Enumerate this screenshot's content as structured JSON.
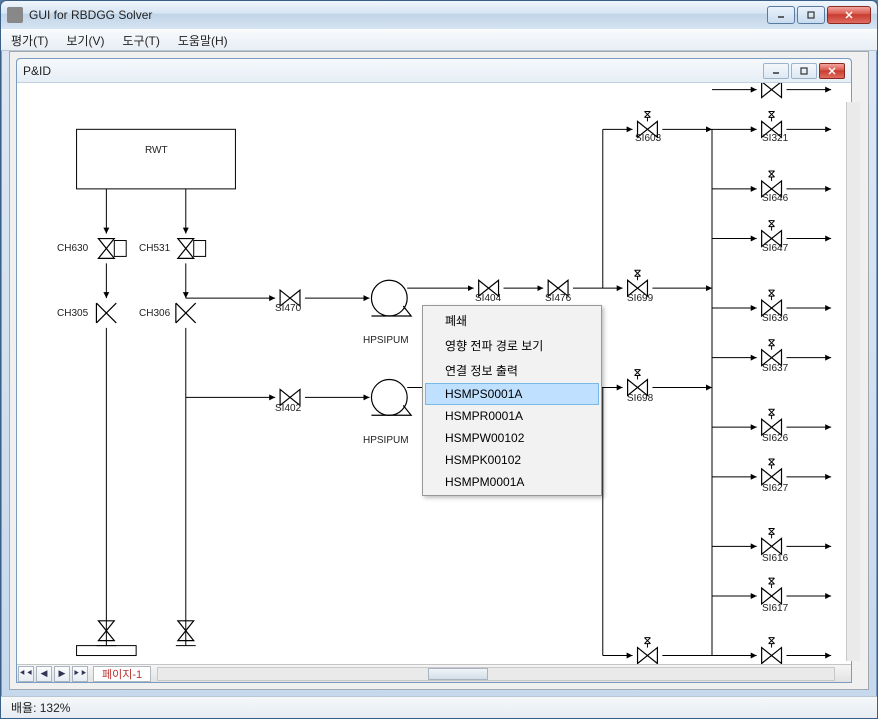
{
  "window": {
    "title": "GUI for RBDGG Solver"
  },
  "menu": {
    "eval": "평가(T)",
    "view": "보기(V)",
    "tool": "도구(T)",
    "help": "도움말(H)"
  },
  "mdi": {
    "title": "P&ID"
  },
  "components": {
    "rwt": "RWT",
    "ch630": "CH630",
    "ch531": "CH531",
    "ch305": "CH305",
    "ch306": "CH306",
    "si470": "SI470",
    "si402": "SI402",
    "hpsipum1": "HPSIPUM",
    "hpsipum2": "HPSIPUM",
    "si404": "SI404",
    "si476": "SI476",
    "si699": "SI699",
    "si698": "SI698",
    "si603": "SI603",
    "si321": "SI321",
    "si646": "SI646",
    "si647": "SI647",
    "si636": "SI636",
    "si637": "SI637",
    "si626": "SI626",
    "si627": "SI627",
    "si616": "SI616",
    "si617": "SI617"
  },
  "context_menu": {
    "close": "폐쇄",
    "show_path": "영향 전파 경로 보기",
    "info_out": "연결 정보 출력",
    "i1": "HSMPS0001A",
    "i2": "HSMPR0001A",
    "i3": "HSMPW00102",
    "i4": "HSMPK00102",
    "i5": "HSMPM0001A"
  },
  "tab": {
    "label": "페이지-1"
  },
  "status": {
    "zoom": "배율: 132%"
  }
}
